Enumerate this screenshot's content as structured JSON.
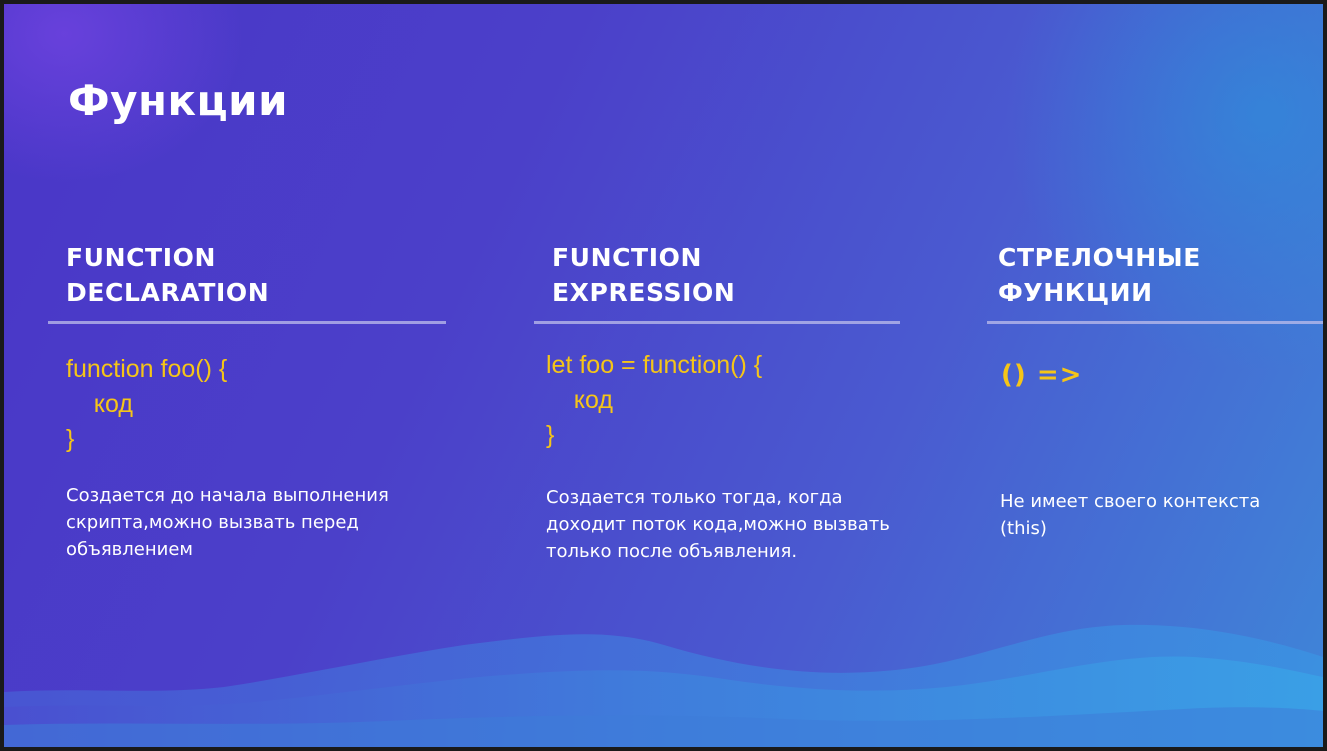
{
  "title": "Функции",
  "columns": [
    {
      "heading": "FUNCTION\nDECLARATION",
      "code": "function foo() {\n    код\n}",
      "description": "Создается до начала выполнения\nскрипта,можно вызвать перед\nобъявлением"
    },
    {
      "heading": "FUNCTION\nEXPRESSION",
      "code": "let foo = function() {\n    код\n}",
      "description": "Создается только тогда, когда\nдоходит поток кода,можно вызвать\nтолько после объявления."
    },
    {
      "heading": "СТРЕЛОЧНЫЕ\nФУНКЦИИ",
      "code": "() =>",
      "description": "Не имеет своего контекста\n(this)"
    }
  ],
  "colors": {
    "background_start": "#4a36c8",
    "background_end": "#3f86d8",
    "code_accent": "#f5c518",
    "text": "#ffffff"
  }
}
